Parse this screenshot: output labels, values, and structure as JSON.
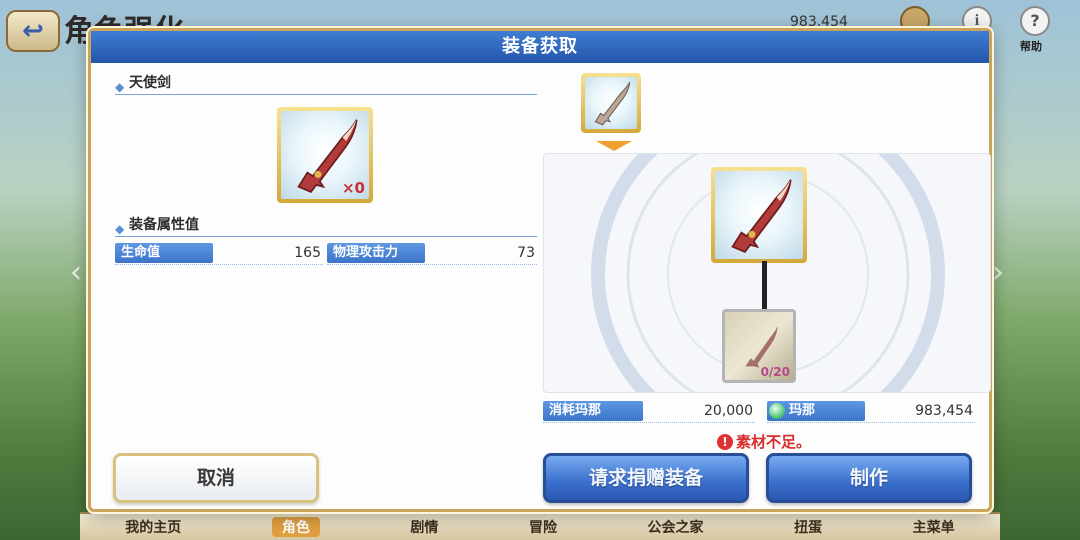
{
  "background": {
    "screen_title": "角色强化",
    "currency_value": "983,454",
    "help_label": "帮助",
    "info_glyph": "i",
    "help_glyph": "?",
    "back_glyph": "↩",
    "nav": [
      "我的主页",
      "角色",
      "剧情",
      "冒险",
      "公会之家",
      "扭蛋",
      "主菜单"
    ],
    "nav_active": "角色"
  },
  "dialog": {
    "title": "装备获取",
    "item_name": "天使剑",
    "item_qty": "×0",
    "stats_heading": "装备属性值",
    "stats": [
      {
        "label": "生命值",
        "value": "165"
      },
      {
        "label": "物理攻击力",
        "value": "73"
      }
    ],
    "material_count": "0/20",
    "cost": {
      "label": "消耗玛那",
      "value": "20,000"
    },
    "mana": {
      "label": "玛那",
      "value": "983,454"
    },
    "warning": "素材不足。",
    "warning_glyph": "!",
    "buttons": {
      "cancel": "取消",
      "request": "请求捐赠装备",
      "craft": "制作"
    }
  },
  "colors": {
    "header_blue": "#2f66bf",
    "gold_frame": "#d4a83a",
    "warning_red": "#d92b2b",
    "button_blue": "#3a6fcd"
  },
  "icons": [
    "back-icon",
    "currency-icon",
    "bag-icon",
    "info-icon",
    "help-icon",
    "sword-icon",
    "material-icon",
    "gem-icon",
    "warning-icon"
  ]
}
